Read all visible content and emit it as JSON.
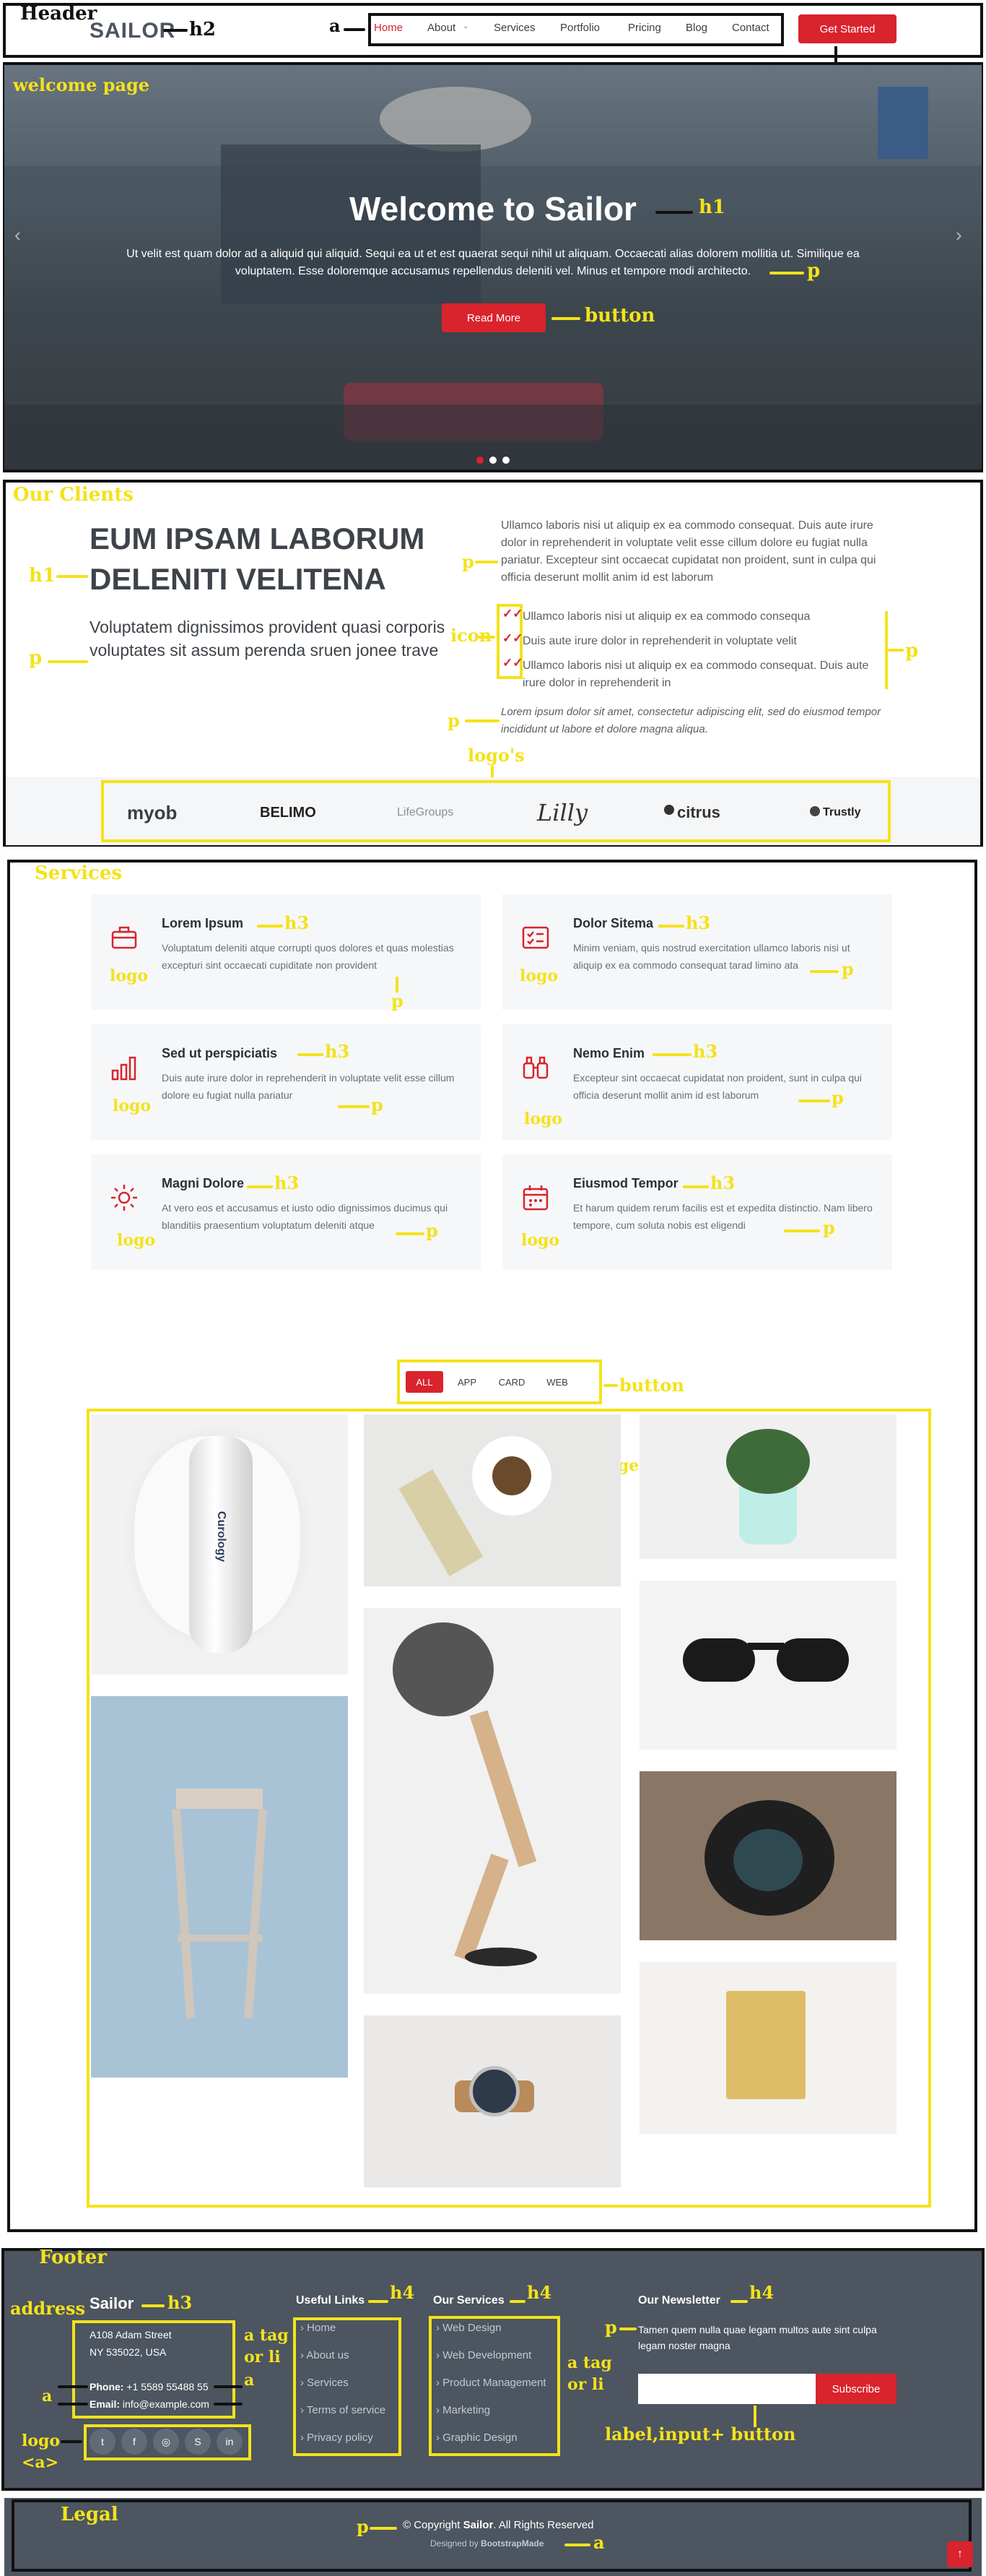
{
  "annotations": {
    "header": "Header",
    "h2": "h2",
    "a": "a",
    "button": "button",
    "welcome_page": "welcome page",
    "h1": "h1",
    "p": "p",
    "our_clients": "Our Clients",
    "icon": "icon",
    "logos": "logo's",
    "services": "Services",
    "h3": "h3",
    "logo": "logo",
    "image": "image",
    "footer": "Footer",
    "address": "address",
    "a_tag_or_li": "a tag or li",
    "h4": "h4",
    "logo_a": "logo <a>",
    "label_input_button": "label,input+ button",
    "legal": "Legal"
  },
  "header": {
    "brand": "SAILOR",
    "nav": [
      "Home",
      "About",
      "Services",
      "Portfolio",
      "Pricing",
      "Blog",
      "Contact"
    ],
    "cta": "Get Started"
  },
  "hero": {
    "title": "Welcome to Sailor",
    "text": "Ut velit est quam dolor ad a aliquid qui aliquid. Sequi ea ut et est quaerat sequi nihil ut aliquam. Occaecati alias dolorem mollitia ut. Similique ea voluptatem. Esse doloremque accusamus repellendus deleniti vel. Minus et tempore modi architecto.",
    "button": "Read More"
  },
  "clients": {
    "heading": "EUM IPSAM LABORUM DELENITI VELITENA",
    "lead": "Voluptatem dignissimos provident quasi corporis voluptates sit assum perenda sruen jonee trave",
    "intro": "Ullamco laboris nisi ut aliquip ex ea commodo consequat. Duis aute irure dolor in reprehenderit in voluptate velit esse cillum dolore eu fugiat nulla pariatur. Excepteur sint occaecat cupidatat non proident, sunt in culpa qui officia deserunt mollit anim id est laborum",
    "list": [
      "Ullamco laboris nisi ut aliquip ex ea commodo consequa",
      "Duis aute irure dolor in reprehenderit in voluptate velit",
      "Ullamco laboris nisi ut aliquip ex ea commodo consequat. Duis aute irure dolor in reprehenderit in"
    ],
    "italic": "Lorem ipsum dolor sit amet, consectetur adipiscing elit, sed do eiusmod tempor incididunt ut labore et dolore magna aliqua.",
    "logos": [
      "myob",
      "BELIMO",
      "LifeGroups",
      "Lilly",
      "citrus",
      "Trustly"
    ]
  },
  "services": {
    "items": [
      {
        "title": "Lorem Ipsum",
        "text": "Voluptatum deleniti atque corrupti quos dolores et quas molestias excepturi sint occaecati cupiditate non provident",
        "icon": "briefcase-icon"
      },
      {
        "title": "Dolor Sitema",
        "text": "Minim veniam, quis nostrud exercitation ullamco laboris nisi ut aliquip ex ea commodo consequat tarad limino ata",
        "icon": "card-checklist-icon"
      },
      {
        "title": "Sed ut perspiciatis",
        "text": "Duis aute irure dolor in reprehenderit in voluptate velit esse cillum dolore eu fugiat nulla pariatur",
        "icon": "bar-chart-icon"
      },
      {
        "title": "Nemo Enim",
        "text": "Excepteur sint occaecat cupidatat non proident, sunt in culpa qui officia deserunt mollit anim id est laborum",
        "icon": "binoculars-icon"
      },
      {
        "title": "Magni Dolore",
        "text": "At vero eos et accusamus et iusto odio dignissimos ducimus qui blanditiis praesentium voluptatum deleniti atque",
        "icon": "brightness-icon"
      },
      {
        "title": "Eiusmod Tempor",
        "text": "Et harum quidem rerum facilis est et expedita distinctio. Nam libero tempore, cum soluta nobis est eligendi",
        "icon": "calendar-icon"
      }
    ]
  },
  "portfolio": {
    "filters": [
      "ALL",
      "APP",
      "CARD",
      "WEB"
    ],
    "bottle_label": "Curology"
  },
  "footer": {
    "brand": "Sailor",
    "address_line1": "A108 Adam Street",
    "address_line2": "NY 535022, USA",
    "phone_label": "Phone:",
    "phone": "+1 5589 55488 55",
    "email_label": "Email:",
    "email": "info@example.com",
    "social": [
      "twitter",
      "facebook",
      "instagram",
      "skype",
      "linkedin"
    ],
    "useful_title": "Useful Links",
    "useful_links": [
      "Home",
      "About us",
      "Services",
      "Terms of service",
      "Privacy policy"
    ],
    "services_title": "Our Services",
    "services_links": [
      "Web Design",
      "Web Development",
      "Product Management",
      "Marketing",
      "Graphic Design"
    ],
    "newsletter_title": "Our Newsletter",
    "newsletter_text": "Tamen quem nulla quae legam multos aute sint culpa legam noster magna",
    "subscribe": "Subscribe"
  },
  "legal": {
    "copyright_prefix": "© Copyright ",
    "copyright_brand": "Sailor",
    "copyright_suffix": ". All Rights Reserved",
    "designed_prefix": "Designed by ",
    "designed_brand": "BootstrapMade"
  }
}
